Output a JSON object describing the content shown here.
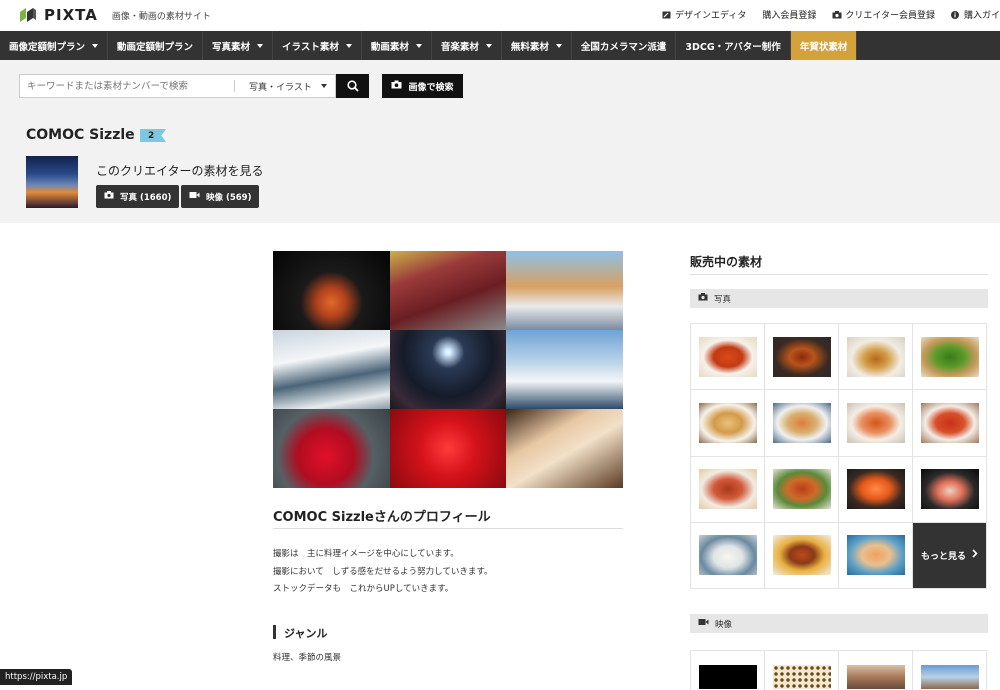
{
  "brand": {
    "name": "PIXTA",
    "tagline": "画像・動画の素材サイト"
  },
  "toplinks": [
    {
      "icon": "pen-square-icon",
      "label": "デザインエディタ"
    },
    {
      "icon": "",
      "label": "購入会員登録"
    },
    {
      "icon": "camera-icon",
      "label": "クリエイター会員登録"
    },
    {
      "icon": "info-icon",
      "label": "購入ガイ"
    }
  ],
  "nav": [
    {
      "label": "画像定額制プラン",
      "caret": true
    },
    {
      "label": "動画定額制プラン",
      "caret": false
    },
    {
      "label": "写真素材",
      "caret": true
    },
    {
      "label": "イラスト素材",
      "caret": true
    },
    {
      "label": "動画素材",
      "caret": true
    },
    {
      "label": "音楽素材",
      "caret": true
    },
    {
      "label": "無料素材",
      "caret": true
    },
    {
      "label": "全国カメラマン派遣",
      "caret": false
    },
    {
      "label": "3DCG・アバター制作",
      "caret": false
    },
    {
      "label": "年賀状素材",
      "caret": false,
      "highlight": true
    }
  ],
  "search": {
    "placeholder": "キーワードまたは素材ナンバーで検索",
    "category": "写真・イラスト",
    "image_search_label": "画像で検索"
  },
  "creator": {
    "name": "COMOC Sizzle",
    "level": "2",
    "see_label": "このクリエイターの素材を見る",
    "photo_btn": "写真 (1660)",
    "video_btn": "映像 (569)"
  },
  "profile": {
    "title": "COMOC Sizzleさんのプロフィール",
    "lines": [
      "撮影は　主に料理イメージを中心にしています。",
      "撮影において　しずる感をだせるよう努力していきます。",
      "ストックデータも　これからUPしていきます。"
    ],
    "genre_title": "ジャンル",
    "genre_value": "料理、季節の風景"
  },
  "sidebar": {
    "title": "販売中の素材",
    "photo_section": "写真",
    "video_section": "映像",
    "more_label": "もっと見る"
  },
  "colors": {
    "nav_bg": "#333333",
    "highlight": "#d4a23b",
    "badge": "#7bc8e0"
  },
  "status_url": "https://pixta.jp"
}
